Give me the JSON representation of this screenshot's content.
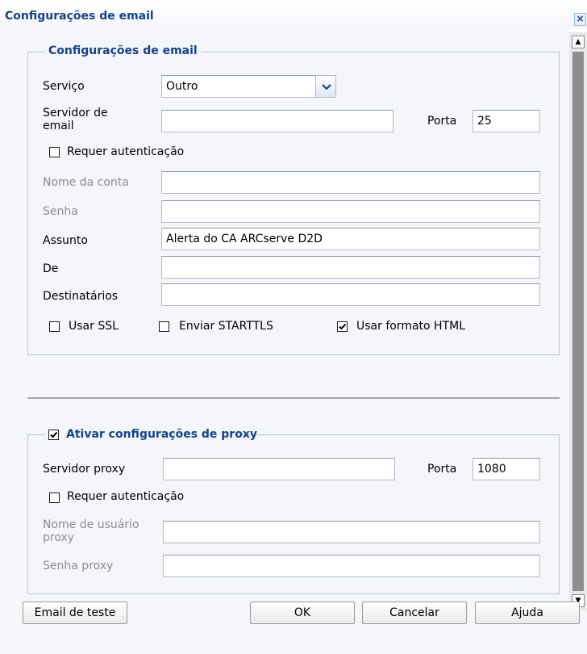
{
  "dialog": {
    "title": "Configurações de email",
    "close_glyph": "×",
    "scroll_up_glyph": "▲",
    "scroll_down_glyph": "▼"
  },
  "email": {
    "legend": "Configurações de email",
    "service": {
      "label": "Serviço",
      "value": "Outro"
    },
    "server": {
      "label": "Servidor de email",
      "value": ""
    },
    "port": {
      "label": "Porta",
      "value": "25"
    },
    "require_auth": {
      "label": "Requer autenticação",
      "checked": false
    },
    "account_name": {
      "label": "Nome da conta",
      "value": ""
    },
    "password": {
      "label": "Senha",
      "value": ""
    },
    "subject": {
      "label": "Assunto",
      "value": "Alerta do CA ARCserve D2D"
    },
    "from": {
      "label": "De",
      "value": ""
    },
    "recipients": {
      "label": "Destinatários",
      "value": ""
    },
    "use_ssl": {
      "label": "Usar SSL",
      "checked": false
    },
    "send_starttls": {
      "label": "Enviar STARTTLS",
      "checked": false
    },
    "use_html": {
      "label": "Usar formato HTML",
      "checked": true
    }
  },
  "proxy": {
    "legend": "Ativar configurações de proxy",
    "enabled": true,
    "server": {
      "label": "Servidor proxy",
      "value": ""
    },
    "port": {
      "label": "Porta",
      "value": "1080"
    },
    "require_auth": {
      "label": "Requer autenticação",
      "checked": false
    },
    "username": {
      "label": "Nome de usuário proxy",
      "value": ""
    },
    "password": {
      "label": "Senha proxy",
      "value": ""
    }
  },
  "buttons": {
    "test_email": "Email de teste",
    "ok": "OK",
    "cancel": "Cancelar",
    "help": "Ajuda"
  },
  "colors": {
    "title": "#15428b",
    "panel_bg": "#f4f6fa",
    "border": "#b6c3d6",
    "disabled_text": "#8c8c8c"
  }
}
